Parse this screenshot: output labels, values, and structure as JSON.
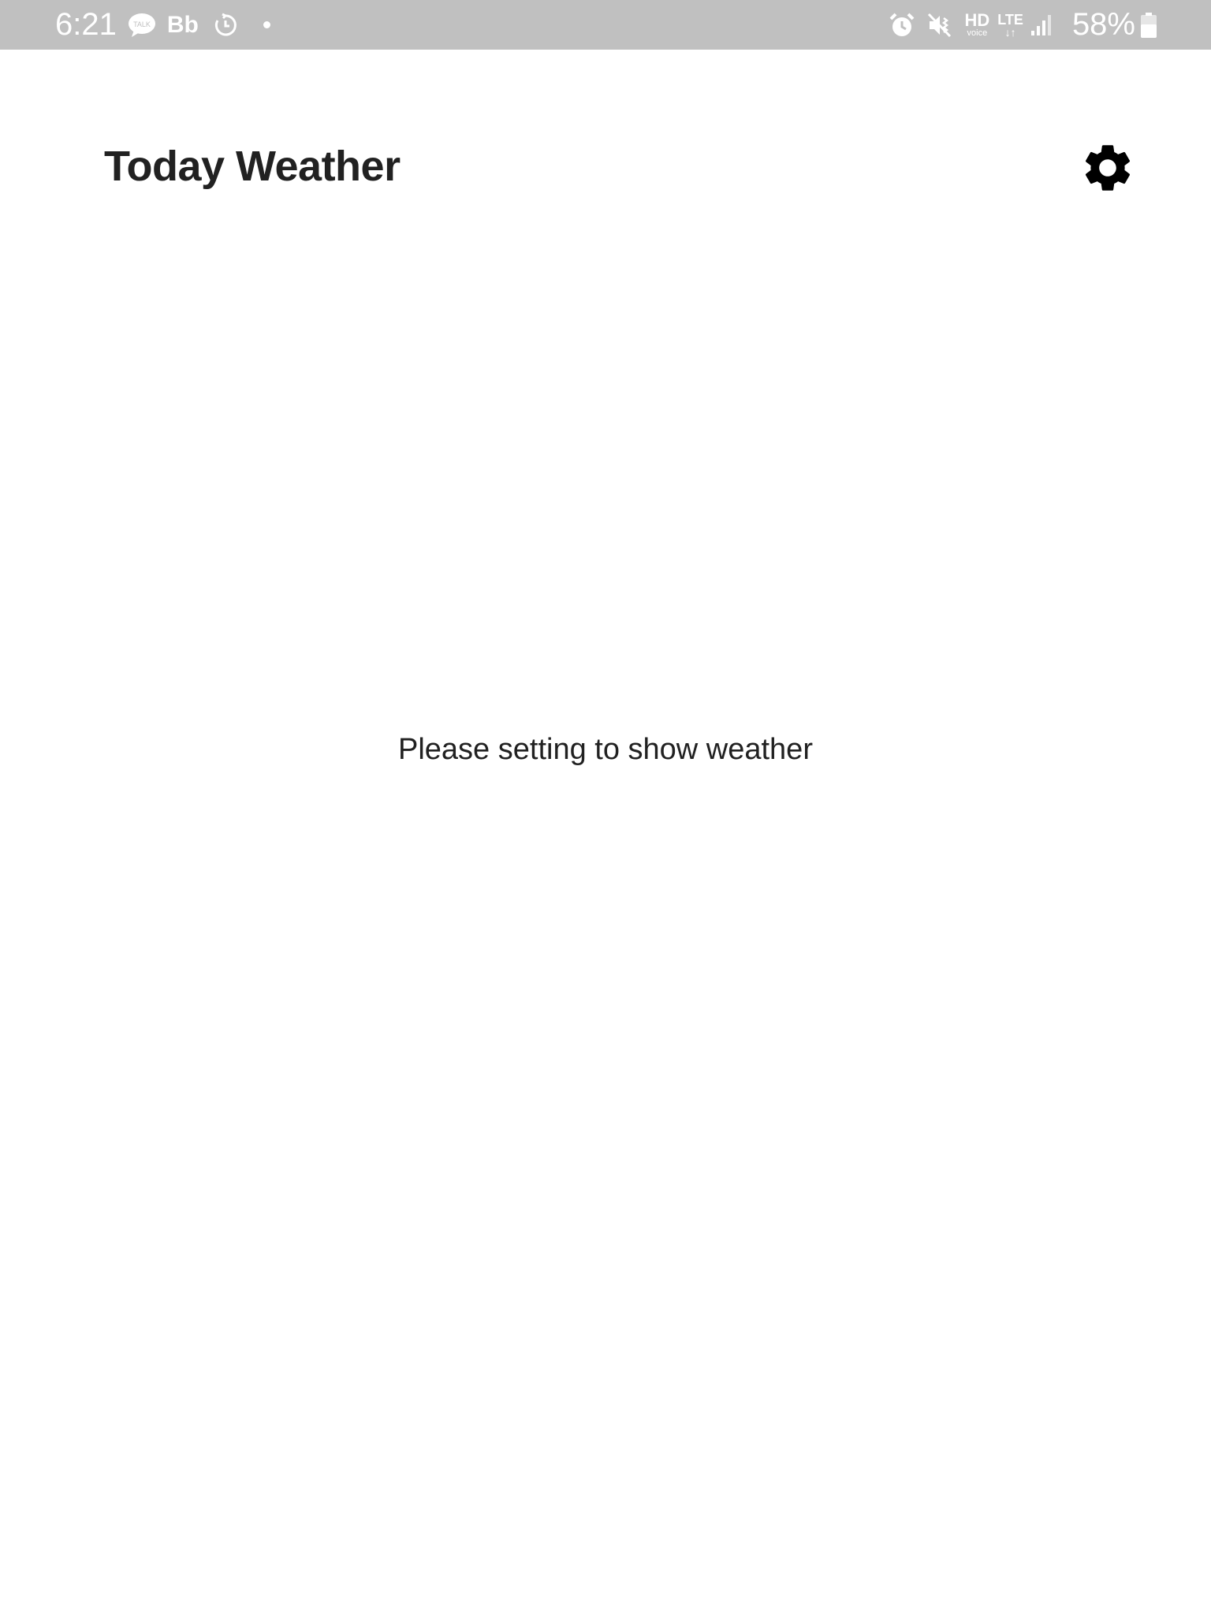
{
  "status_bar": {
    "time": "6:21",
    "notification_icons": [
      "kakaotalk-icon",
      "bb-icon",
      "timer-icon",
      "dot-icon"
    ],
    "bb_label": "Bb",
    "talk_label": "TALK",
    "hd_label": "HD",
    "hd_sub_label": "voice",
    "lte_label": "LTE",
    "lte_arrows": "↓↑",
    "battery_percent": "58%",
    "background_color": "#c0c0c0"
  },
  "header": {
    "title": "Today Weather",
    "settings_icon": "gear-icon"
  },
  "main": {
    "empty_message": "Please setting to show weather"
  }
}
